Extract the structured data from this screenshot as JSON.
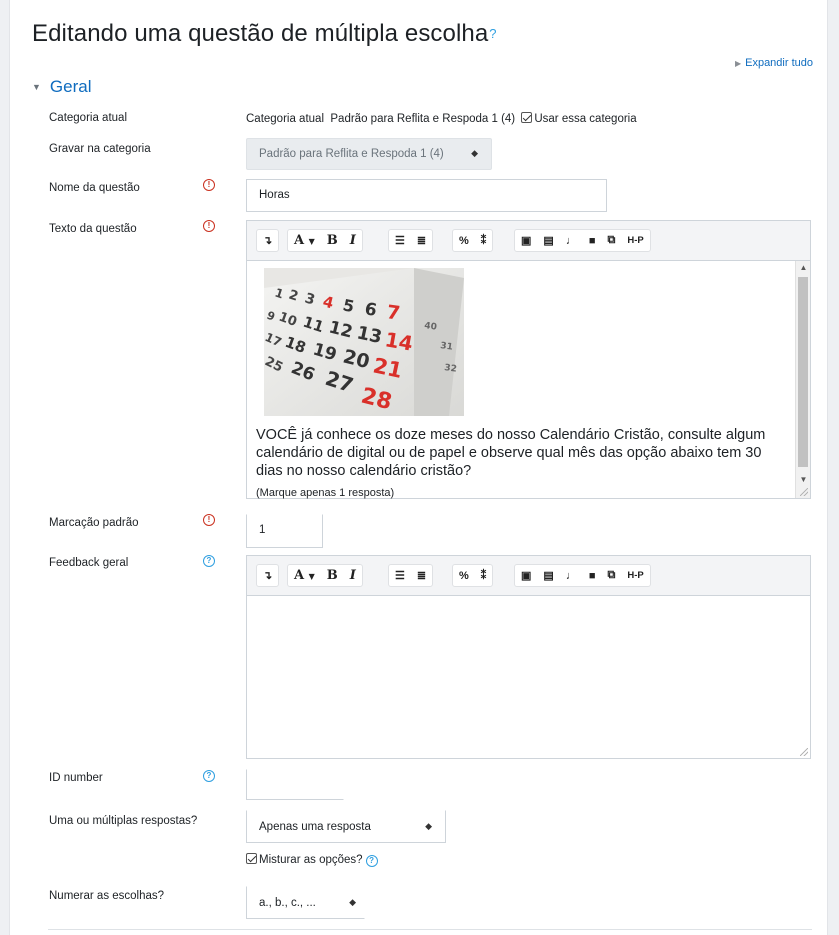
{
  "page_title": "Editando uma questão de múltipla escolha",
  "expand_all": "Expandir tudo",
  "section": "Geral",
  "fields": {
    "current_category": {
      "label": "Categoria atual",
      "static_prefix": "Categoria atual",
      "static_value": "Padrão para Reflita e Respoda 1 (4)",
      "checkbox_label": "Usar essa categoria"
    },
    "save_category": {
      "label": "Gravar na categoria",
      "selected": "Padrão para Reflita e Respoda 1 (4)"
    },
    "question_name": {
      "label": "Nome da questão",
      "value": "Horas"
    },
    "question_text": {
      "label": "Texto da questão",
      "body": "VOCÊ já conhece os doze meses do nosso Calendário Cristão, consulte algum calendário de digital ou de papel e observe qual mês das opção abaixo tem 30 dias no nosso calendário cristão?",
      "note": "(Marque apenas 1 resposta)"
    },
    "default_mark": {
      "label": "Marcação padrão",
      "value": "1"
    },
    "general_feedback": {
      "label": "Feedback geral",
      "body": ""
    },
    "id_number": {
      "label": "ID number",
      "value": ""
    },
    "single_multiple": {
      "label": "Uma ou múltiplas respostas?",
      "selected": "Apenas uma resposta"
    },
    "shuffle": {
      "label": "Misturar as opções?",
      "checked": true
    },
    "numbering": {
      "label": "Numerar as escolhas?",
      "selected": "a., b., c., ..."
    }
  },
  "toolbar": {
    "font_label": "A",
    "bold_label": "B",
    "italic_label": "I",
    "h5p_label": "H-P"
  },
  "colors": {
    "accent": "#0f6cbf",
    "required": "#ca3120",
    "help": "#2f9fe0",
    "calendar_red": "#d9302a"
  },
  "icons": [
    "expand-triangle-icon",
    "collapse-caret-icon",
    "required-icon",
    "help-icon",
    "checkbox-checked-icon",
    "select-arrows-icon"
  ]
}
